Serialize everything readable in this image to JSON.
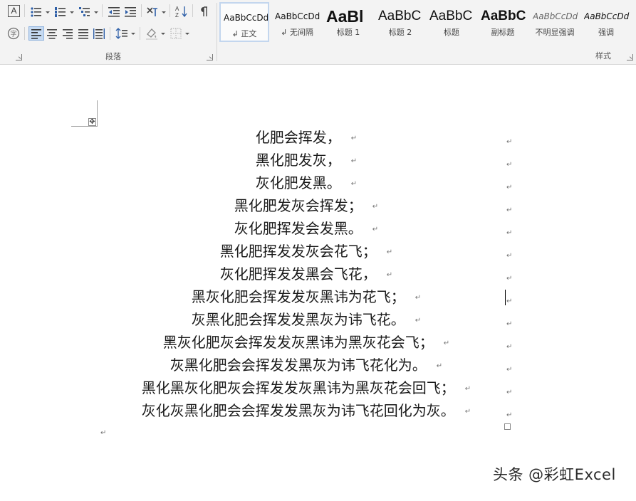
{
  "ribbon": {
    "paragraph_group_label": "段落",
    "styles_group_label": "样式",
    "styles": [
      {
        "preview": "AaBbCcDd",
        "name": "↲ 正文",
        "selected": true
      },
      {
        "preview": "AaBbCcDd",
        "name": "↲ 无间隔",
        "selected": false
      },
      {
        "preview": "AaBl",
        "name": "标题 1",
        "selected": false
      },
      {
        "preview": "AaBbC",
        "name": "标题 2",
        "selected": false
      },
      {
        "preview": "AaBbC",
        "name": "标题",
        "selected": false
      },
      {
        "preview": "AaBbC",
        "name": "副标题",
        "selected": false
      },
      {
        "preview": "AaBbCcDd",
        "name": "不明显强调",
        "selected": false
      },
      {
        "preview": "AaBbCcDd",
        "name": "强调",
        "selected": false
      }
    ],
    "icons": {
      "char_border": "A",
      "char_circle": "字"
    },
    "colors": {
      "accent": "#c3d6ee",
      "ribbon_bg": "#f3f3f3",
      "spell_error": "#e03030",
      "grammar_error": "#3355dd"
    }
  },
  "document": {
    "paragraph_mark": "↵",
    "move_handle": "✥",
    "lines": [
      "化肥会挥发，",
      "黑化肥发灰，",
      "灰化肥发黑。",
      "黑化肥发灰会挥发；",
      "灰化肥挥发会发黑。",
      "黑化肥挥发发灰会花飞；",
      "灰化肥挥发发黑会飞花，",
      "黑灰化肥会挥发发灰黑讳为花飞；",
      "灰黑化肥会挥发发黑灰为讳飞花。",
      "黑灰化肥灰会挥发发灰黑讳为黑灰花会飞；",
      "灰黑化肥会会挥发发黑灰为讳飞花化为。",
      "黑化黑灰化肥灰会挥发发灰黑讳为黑灰花会回飞；",
      "灰化灰黑化肥会会挥发发黑灰为讳飞花回化为灰。"
    ]
  },
  "watermark": "头条 @彩虹Excel"
}
